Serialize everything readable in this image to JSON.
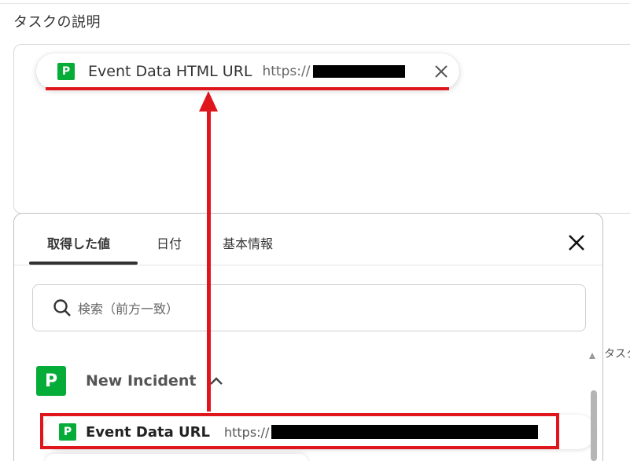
{
  "section": {
    "title": "タスクの説明"
  },
  "chip": {
    "label": "Event Data HTML URL",
    "url_prefix": "https://",
    "logo_letter": "P"
  },
  "panel": {
    "tabs": [
      {
        "label": "取得した値",
        "active": true
      },
      {
        "label": "日付",
        "active": false
      },
      {
        "label": "基本情報",
        "active": false
      }
    ],
    "search_placeholder": "検索（前方一致）",
    "group": {
      "name": "New Incident",
      "logo_letter": "P",
      "expanded": true
    },
    "item": {
      "label": "Event Data URL",
      "url_prefix": "https://",
      "logo_letter": "P"
    }
  },
  "side_label": "タスク",
  "colors": {
    "highlight": "#e0161d",
    "pagerduty_green": "#06ac38"
  },
  "icons": [
    "pagerduty-logo-icon",
    "close-icon",
    "search-icon",
    "chevron-up-icon",
    "arrow-up-annotation"
  ]
}
